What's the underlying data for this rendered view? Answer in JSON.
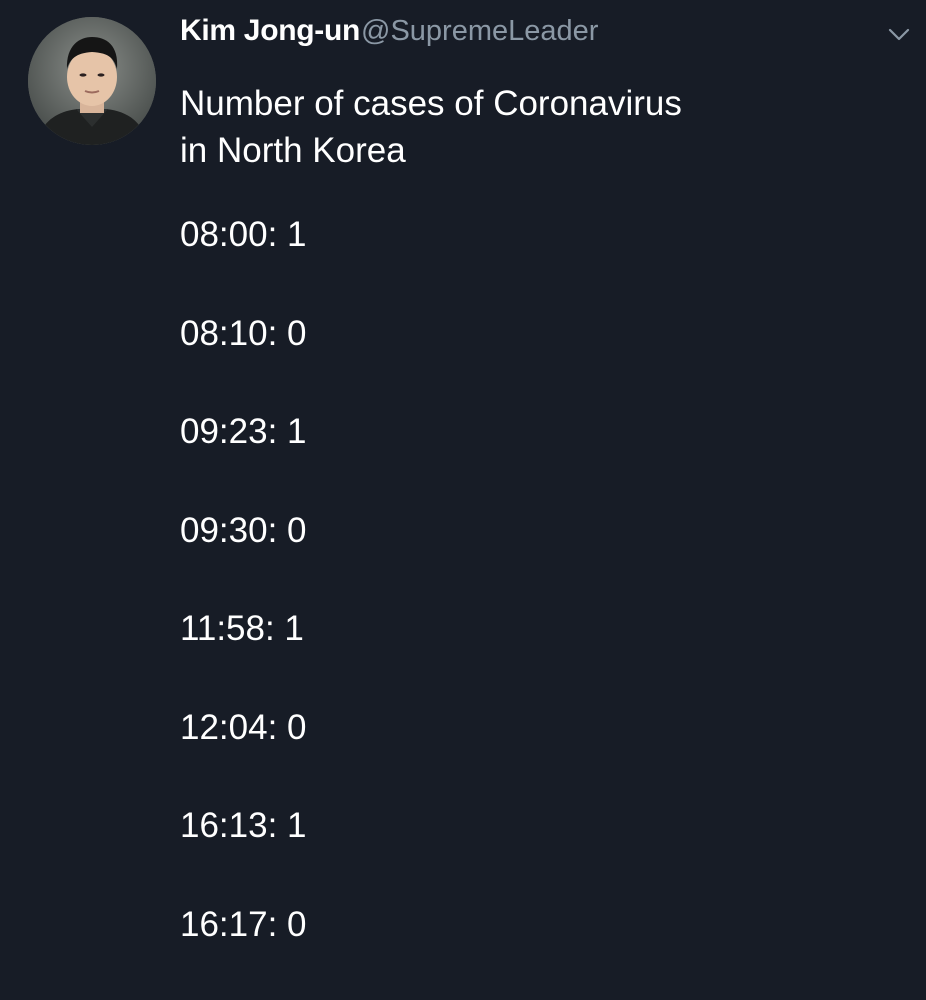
{
  "author": {
    "display_name": "Kim Jong-un",
    "handle": "@SupremeLeader",
    "avatar_icon": "profile-photo"
  },
  "menu": {
    "icon": "chevron-down-icon"
  },
  "tweet": {
    "text_lines": [
      "Number of cases of Coronavirus",
      "in North Korea"
    ],
    "entries": [
      "08:00: 1",
      "08:10: 0",
      "09:23: 1",
      "09:30: 0",
      "11:58: 1",
      "12:04: 0",
      "16:13: 1",
      "16:17: 0"
    ]
  },
  "colors": {
    "background": "#171c26",
    "primary_text": "#ffffff",
    "secondary_text": "#8b98a5"
  }
}
